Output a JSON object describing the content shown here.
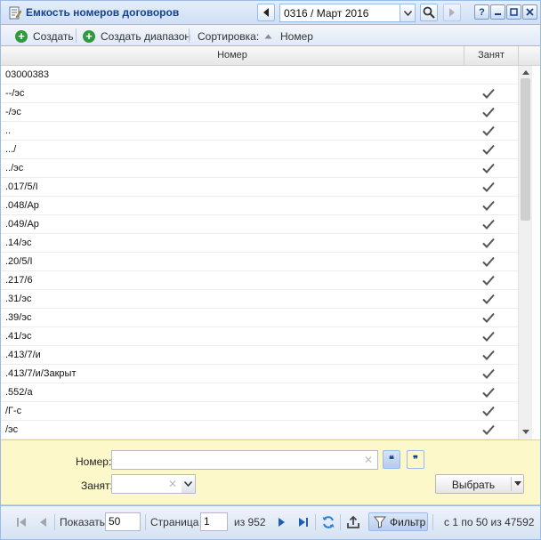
{
  "window": {
    "title": "Емкость номеров договоров",
    "period": "0316 / Март 2016",
    "help_label": "?"
  },
  "toolbar": {
    "create_label": "Создать",
    "create_range_label": "Создать диапазон",
    "sort_label": "Сортировка:",
    "sort_field": "Номер"
  },
  "grid": {
    "columns": [
      "Номер",
      "Занят"
    ],
    "rows": [
      {
        "number": "03000383",
        "taken": false
      },
      {
        "number": "--/эс",
        "taken": true
      },
      {
        "number": "-/эс",
        "taken": true
      },
      {
        "number": "..",
        "taken": true
      },
      {
        "number": ".../",
        "taken": true
      },
      {
        "number": "../эс",
        "taken": true
      },
      {
        "number": ".017/5/I",
        "taken": true
      },
      {
        "number": ".048/Ар",
        "taken": true
      },
      {
        "number": ".049/Ар",
        "taken": true
      },
      {
        "number": ".14/эс",
        "taken": true
      },
      {
        "number": ".20/5/I",
        "taken": true
      },
      {
        "number": ".217/6",
        "taken": true
      },
      {
        "number": ".31/эс",
        "taken": true
      },
      {
        "number": ".39/эс",
        "taken": true
      },
      {
        "number": ".41/эс",
        "taken": true
      },
      {
        "number": ".413/7/и",
        "taken": true
      },
      {
        "number": ".413/7/и/Закрыт",
        "taken": true
      },
      {
        "number": ".552/а",
        "taken": true
      },
      {
        "number": "/Г-с",
        "taken": true
      },
      {
        "number": "/эс",
        "taken": true
      }
    ]
  },
  "filter": {
    "number_label": "Номер:",
    "number_value": "",
    "taken_label": "Занят:",
    "taken_value": "",
    "choose_label": "Выбрать"
  },
  "paging": {
    "show_label": "Показать",
    "page_size": "50",
    "page_label": "Страница",
    "page_value": "1",
    "of_pages": "из 952",
    "filter_label": "Фильтр",
    "summary": "с 1 по 50 из 47592"
  },
  "colors": {
    "accent": "#15428b",
    "border": "#99bbe8",
    "filter_bg": "#fdf8c9",
    "create_green": "#2f9a3b"
  }
}
